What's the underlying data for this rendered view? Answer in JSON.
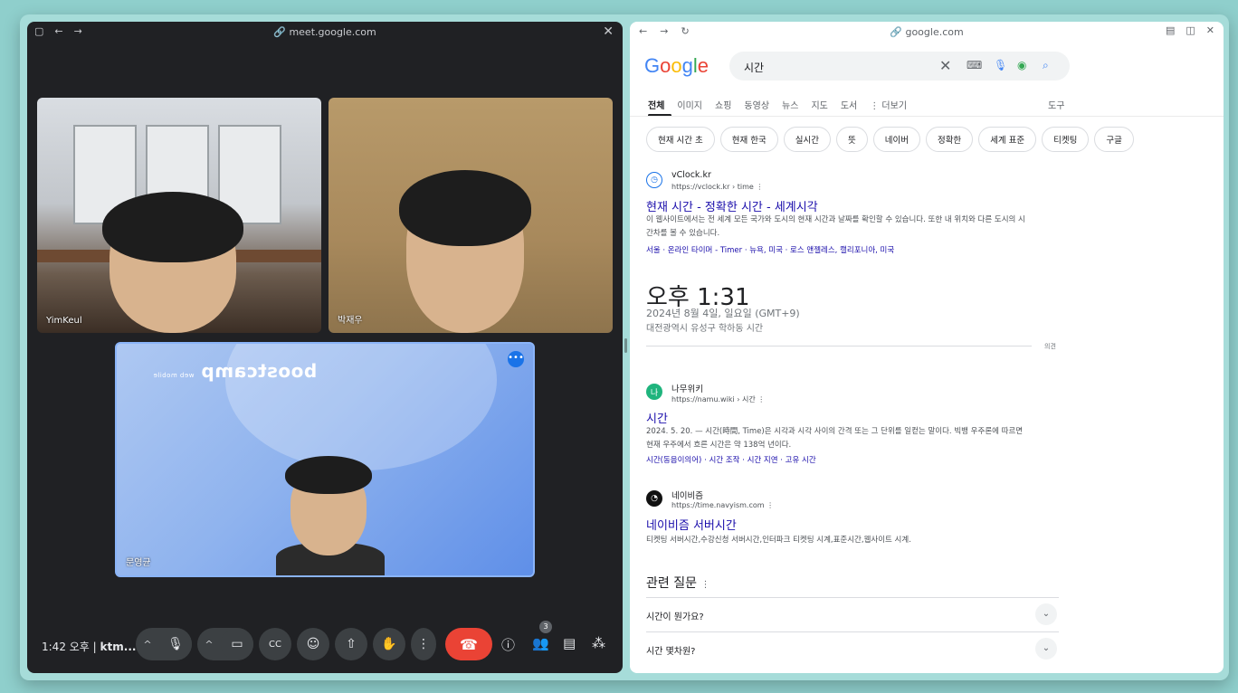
{
  "meet": {
    "url": "meet.google.com",
    "participants": [
      {
        "name": "YimKeul"
      },
      {
        "name": "박재우"
      },
      {
        "name": "문영균"
      }
    ],
    "presentation_brand": "boostcamp",
    "presentation_sub": "web mobile",
    "controls": {
      "time": "1:42 오후",
      "separator": "|",
      "meeting_code": "ktm...",
      "participant_count": "3"
    }
  },
  "browser": {
    "url": "google.com",
    "search_query": "시간",
    "tabs": [
      "전체",
      "이미지",
      "쇼핑",
      "동영상",
      "뉴스",
      "지도",
      "도서",
      "⋮ 더보기"
    ],
    "tools_label": "도구",
    "chips": [
      "현재 시간 초",
      "현재 한국",
      "실시간",
      "뜻",
      "네이버",
      "정확한",
      "세계 표준",
      "티켓팅",
      "구글"
    ],
    "results": [
      {
        "site": "vClock.kr",
        "url": "https://vclock.kr › time",
        "title": "현재 시간 - 정확한 시간 - 세계시각",
        "snippet": "이 웹사이트에서는 전 세계 모든 국가와 도시의 현재 시간과 날짜를 확인할 수 있습니다. 또한 내 위치와 다른 도시의 시간차를 볼 수 있습니다.",
        "links": "서울 · 온라인 타이머 - Timer · 뉴욕, 미국 · 로스 앤젤레스, 캘리포니아, 미국"
      },
      {
        "site": "나무위키",
        "url": "https://namu.wiki › 시간",
        "title": "시간",
        "snippet": "2024. 5. 20. — 시간(時間, Time)은 시각과 시각 사이의 간격 또는 그 단위를 일컫는 말이다. 빅뱅 우주론에 따르면 현재 우주에서 흐른 시간은 약 138억 년이다.",
        "links": "시간(동음이의어) · 시간 조작 · 시간 지연 · 고유 시간"
      },
      {
        "site": "네이비즘",
        "url": "https://time.navyism.com",
        "title": "네이비즘 서버시간",
        "snippet": "티켓팅 서버시간,수강신청 서버시간,인터파크 티켓팅 시계,표준시간,웹사이트 시계.",
        "links": ""
      }
    ],
    "time_widget": {
      "time": "오후 1:31",
      "date": "2024년 8월 4일, 일요일 (GMT+9)",
      "location": "대전광역시 유성구 학하동 시간",
      "feedback": "의견"
    },
    "related_questions": {
      "title": "관련 질문",
      "items": [
        "시간이 뭔가요?",
        "시간 몇차원?"
      ]
    },
    "colors": {
      "link": "#1a0dab",
      "end_call": "#ea4335",
      "meet_bg": "#202124"
    }
  }
}
